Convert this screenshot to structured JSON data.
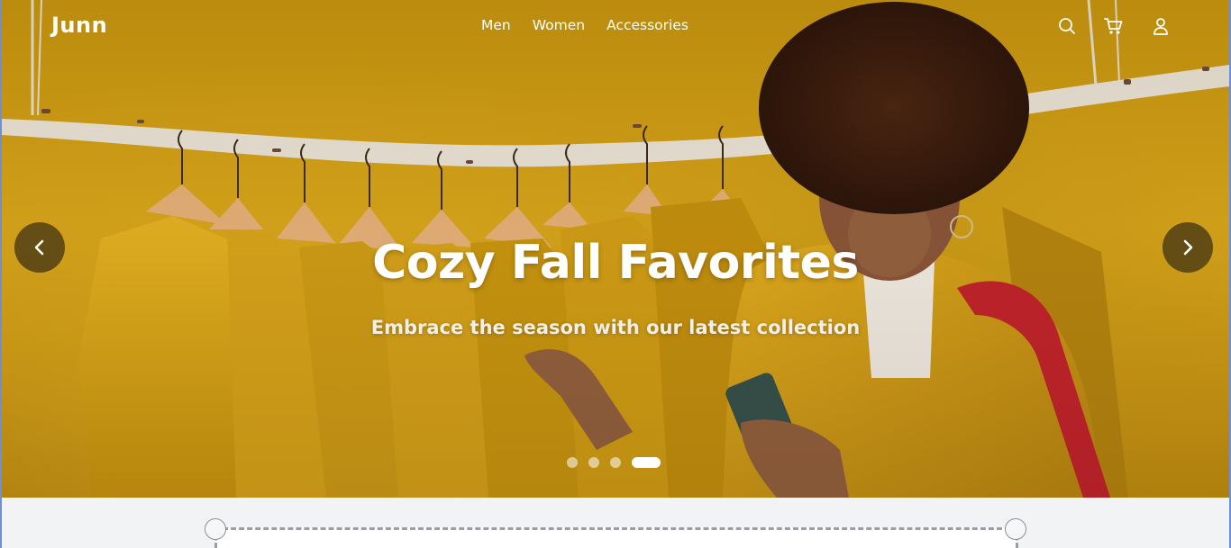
{
  "brand": {
    "logo": "Junn"
  },
  "nav": {
    "links": [
      "Men",
      "Women",
      "Accessories"
    ],
    "icons": [
      "search-icon",
      "cart-icon",
      "user-icon"
    ]
  },
  "hero": {
    "title": "Cozy Fall Favorites",
    "subtitle": "Embrace the season with our latest collection",
    "prev_icon": "chevron-left-icon",
    "next_icon": "chevron-right-icon",
    "slide_count": 4,
    "active_slide": 4
  },
  "colors": {
    "hero_background": "#d1a015",
    "text": "#ffffff",
    "arrow_background": "#463714",
    "page_background": "#f2f3f5",
    "frame": "#6d8fd6"
  }
}
